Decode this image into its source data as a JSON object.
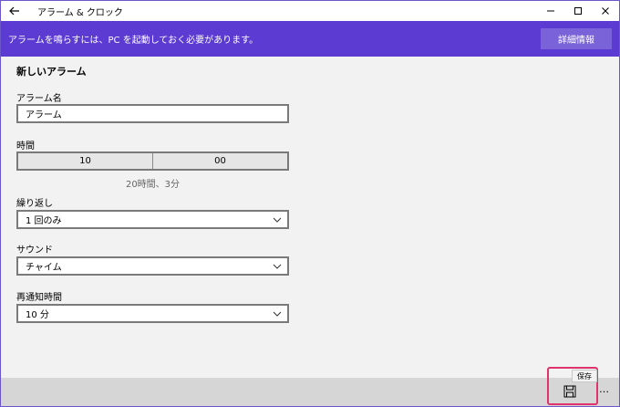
{
  "window": {
    "title": "アラーム & クロック"
  },
  "banner": {
    "message": "アラームを鳴らすには、PC を起動しておく必要があります。",
    "details_label": "詳細情報"
  },
  "form": {
    "section_title": "新しいアラーム",
    "name": {
      "label": "アラーム名",
      "value": "アラーム"
    },
    "time": {
      "label": "時間",
      "hour": "10",
      "minute": "00",
      "hint": "20時間、3分"
    },
    "repeat": {
      "label": "繰り返し",
      "value": "1 回のみ"
    },
    "sound": {
      "label": "サウンド",
      "value": "チャイム"
    },
    "snooze": {
      "label": "再通知時間",
      "value": "10 分"
    }
  },
  "cmdbar": {
    "save_tooltip": "保存",
    "more": "…"
  },
  "colors": {
    "accent": "#5b3bd1",
    "details_button": "#7a63d8",
    "highlight": "#e0326e"
  },
  "icons": [
    "back-arrow-icon",
    "minimize-icon",
    "maximize-icon",
    "close-icon",
    "chevron-down-icon",
    "save-icon",
    "more-icon"
  ]
}
